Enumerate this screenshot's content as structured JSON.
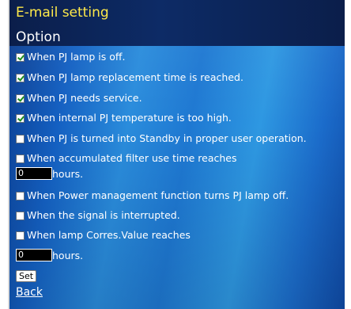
{
  "header": {
    "title": "E-mail setting",
    "subtitle": "Option"
  },
  "options": [
    {
      "label": "When PJ lamp is off.",
      "checked": true
    },
    {
      "label": "When PJ lamp replacement time is reached.",
      "checked": true
    },
    {
      "label": "When PJ needs service.",
      "checked": true
    },
    {
      "label": "When internal PJ temperature is too high.",
      "checked": true
    },
    {
      "label": "When PJ is turned into Standby in proper user operation.",
      "checked": false
    },
    {
      "label": "When accumulated filter use time reaches",
      "checked": false
    },
    {
      "label": "When Power management function turns PJ lamp off.",
      "checked": false
    },
    {
      "label": "When the signal is interrupted.",
      "checked": false
    },
    {
      "label": "When lamp Corres.Value reaches",
      "checked": false
    }
  ],
  "filter_hours": {
    "value": "0",
    "unit": "hours."
  },
  "lamp_hours": {
    "value": "0",
    "unit": "hours."
  },
  "buttons": {
    "set_label": "Set"
  },
  "links": {
    "back_label": "Back"
  },
  "colors": {
    "title": "#ffe94a",
    "header_bg": "#0d2b66",
    "panel_blue": "#2a8cdc"
  }
}
